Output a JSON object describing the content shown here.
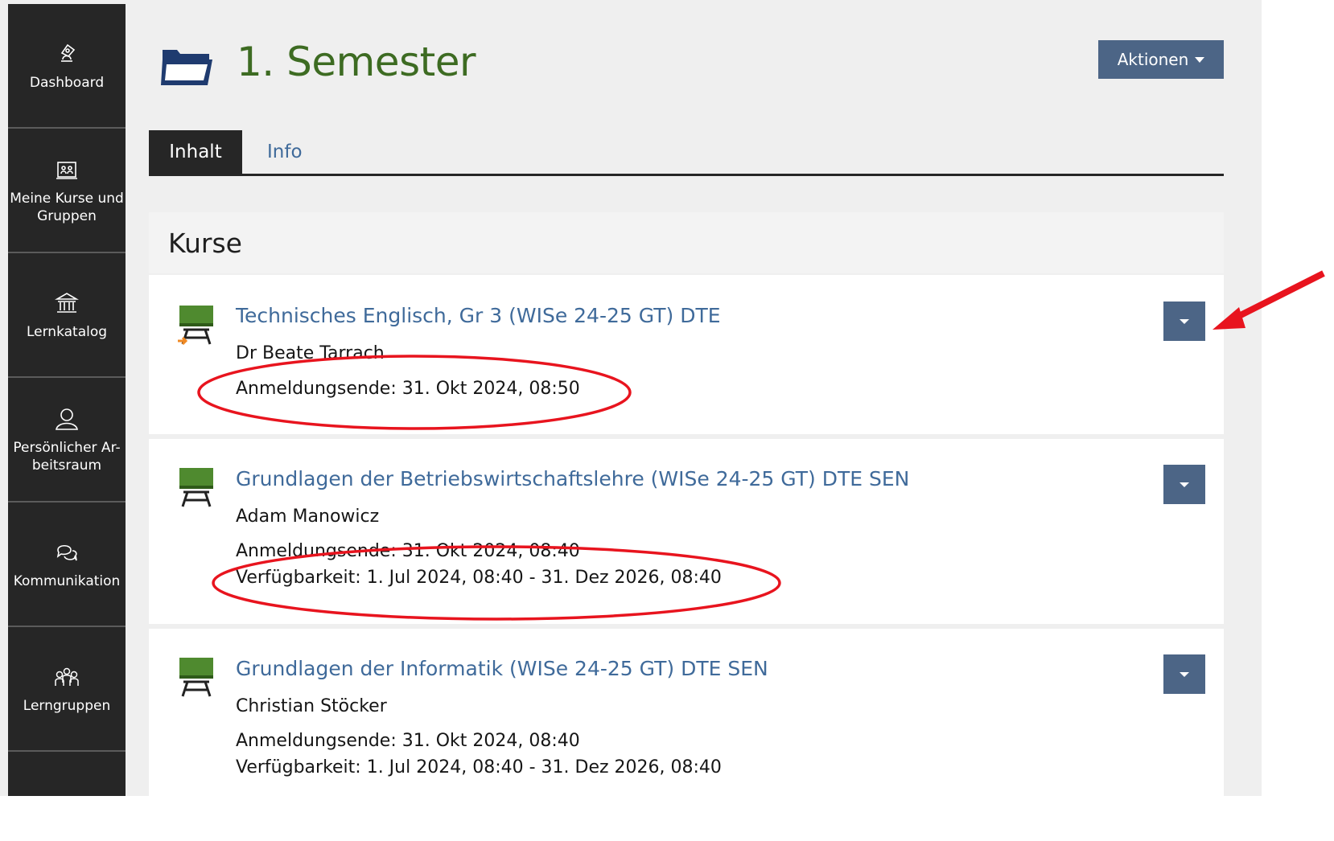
{
  "sidebar": {
    "items": [
      {
        "label": "Dashboard",
        "icon": "dashboard-icon"
      },
      {
        "label": "Meine Kurse und\nGruppen",
        "icon": "courses-groups-icon"
      },
      {
        "label": "Lernkatalog",
        "icon": "catalog-icon"
      },
      {
        "label": "Persönlicher Ar-\nbeitsraum",
        "icon": "person-icon"
      },
      {
        "label": "Kommunikation",
        "icon": "chat-icon"
      },
      {
        "label": "Lerngruppen",
        "icon": "groups-icon"
      }
    ]
  },
  "header": {
    "title": "1. Semester",
    "actions_label": "Aktionen"
  },
  "tabs": [
    {
      "label": "Inhalt",
      "active": true
    },
    {
      "label": "Info",
      "active": false
    }
  ],
  "section": {
    "title": "Kurse"
  },
  "courses": [
    {
      "title": "Technisches Englisch, Gr 3 (WISe 24-25 GT) DTE",
      "tutor": "Dr Beate Tarrach",
      "lines": [
        "Anmeldungsende: 31. Okt 2024, 08:50"
      ]
    },
    {
      "title": "Grundlagen der Betriebswirtschaftslehre (WISe 24-25 GT) DTE SEN",
      "tutor": "Adam Manowicz",
      "lines": [
        "Anmeldungsende: 31. Okt 2024, 08:40",
        "Verfügbarkeit: 1. Jul 2024, 08:40 - 31. Dez 2026, 08:40"
      ]
    },
    {
      "title": "Grundlagen der Informatik (WISe 24-25 GT) DTE SEN",
      "tutor": "Christian Stöcker",
      "lines": [
        "Anmeldungsende: 31. Okt 2024, 08:40",
        "Verfügbarkeit: 1. Jul 2024, 08:40 - 31. Dez 2026, 08:40"
      ]
    }
  ],
  "colors": {
    "title_green": "#3d6b22",
    "link_blue": "#3f6a9a",
    "button_blue": "#4c6586",
    "sidebar_dark": "#262626",
    "annotation_red": "#e8141e"
  }
}
